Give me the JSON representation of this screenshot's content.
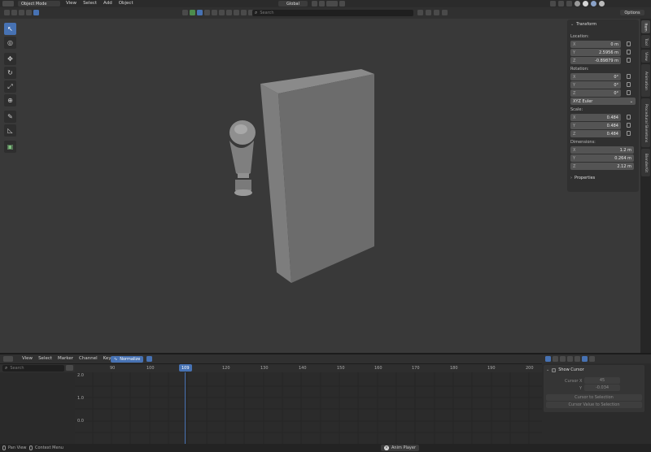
{
  "header": {
    "mode": "Object Mode",
    "menus": [
      "View",
      "Select",
      "Add",
      "Object"
    ],
    "orientation": "Global",
    "search_placeholder": "Search",
    "options_label": "Options"
  },
  "npanel": {
    "section_transform": "Transform",
    "location_label": "Location:",
    "location": [
      {
        "axis": "X",
        "value": "0 m"
      },
      {
        "axis": "Y",
        "value": "2.5956 m"
      },
      {
        "axis": "Z",
        "value": "-0.89879 m"
      }
    ],
    "rotation_label": "Rotation:",
    "rotation": [
      {
        "axis": "X",
        "value": "0°"
      },
      {
        "axis": "Y",
        "value": "0°"
      },
      {
        "axis": "Z",
        "value": "0°"
      }
    ],
    "rotation_mode": "XYZ Euler",
    "scale_label": "Scale:",
    "scale": [
      {
        "axis": "X",
        "value": "0.484"
      },
      {
        "axis": "Y",
        "value": "0.484"
      },
      {
        "axis": "Z",
        "value": "0.484"
      }
    ],
    "dimensions_label": "Dimensions:",
    "dimensions": [
      {
        "axis": "X",
        "value": "1.2 m"
      },
      {
        "axis": "Y",
        "value": "0.264 m"
      },
      {
        "axis": "Z",
        "value": "2.12 m"
      }
    ],
    "section_properties": "Properties"
  },
  "side_tabs": [
    "Item",
    "Tool",
    "View",
    "Animation",
    "Procedural Skeletons",
    "BlenderKit"
  ],
  "timeline": {
    "menus": [
      "View",
      "Select",
      "Marker",
      "Channel",
      "Key"
    ],
    "normalize_label": "Normalize",
    "search_placeholder": "Search",
    "ticks": [
      "90",
      "100",
      "110",
      "120",
      "130",
      "140",
      "150",
      "160",
      "170",
      "180",
      "190",
      "200"
    ],
    "current_frame": "109",
    "y_labels": [
      "2.0",
      "1.0",
      "0.0"
    ],
    "cursor_panel": {
      "title": "Show Cursor",
      "cursor_x_label": "Cursor X",
      "cursor_x_value": "45",
      "y_label": "Y",
      "y_value": "-0.034",
      "btn_to_selection": "Cursor to Selection",
      "btn_value_to_selection": "Cursor Value to Selection"
    }
  },
  "status": {
    "pan_view": "Pan View",
    "context_menu": "Context Menu",
    "anim_player": "Anim Player"
  },
  "colors": {
    "accent": "#4772b3",
    "viewport_bg": "#393939",
    "header_bg": "#2b2b2b"
  }
}
